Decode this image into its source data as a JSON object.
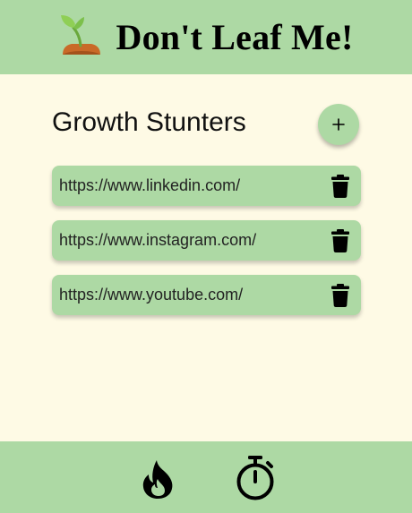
{
  "header": {
    "title": "Don't Leaf Me!",
    "logo_icon": "sprout-icon"
  },
  "main": {
    "section_title": "Growth Stunters",
    "add_label": "+",
    "sites": [
      {
        "url": "https://www.linkedin.com/"
      },
      {
        "url": "https://www.instagram.com/"
      },
      {
        "url": "https://www.youtube.com/"
      }
    ]
  },
  "footer": {
    "nav": [
      {
        "icon": "fire-icon"
      },
      {
        "icon": "stopwatch-icon"
      }
    ]
  },
  "colors": {
    "header_bg": "#add9a4",
    "page_bg": "#fefae5",
    "row_bg": "#add9a4",
    "soil": "#c96a28",
    "leaf": "#7cc04b"
  }
}
